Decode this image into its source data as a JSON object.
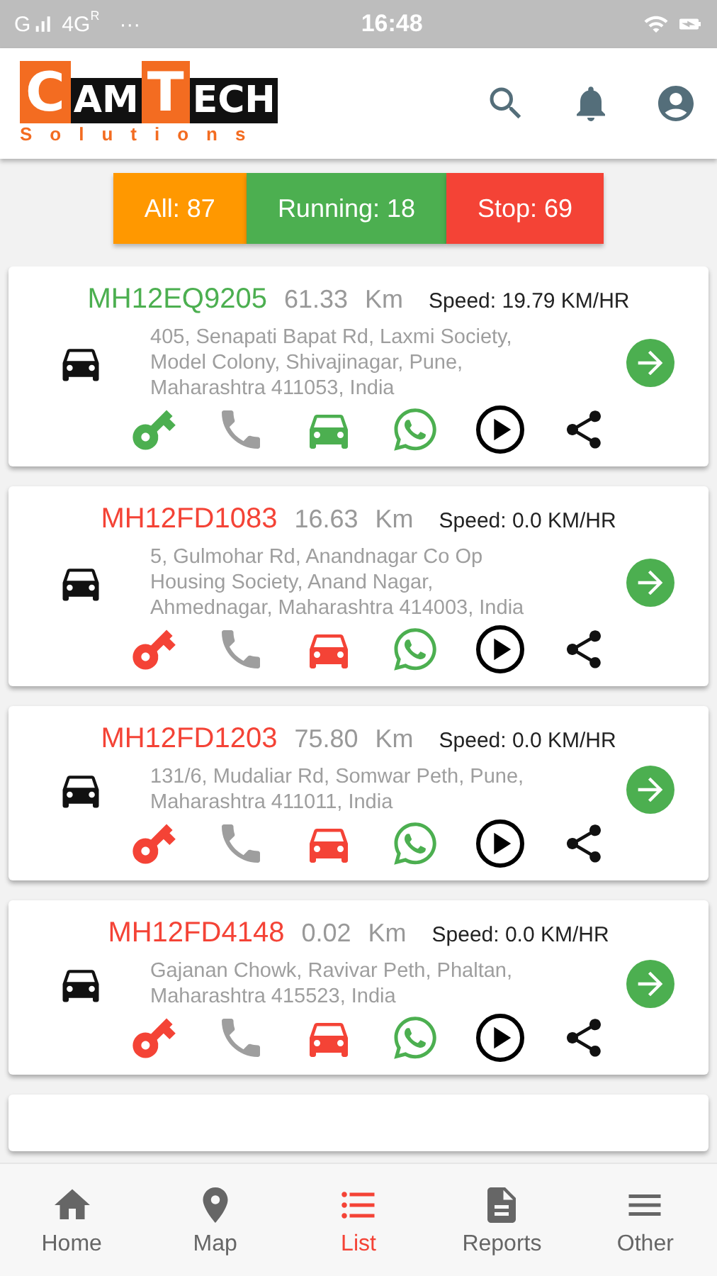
{
  "status_bar": {
    "carrier": "G",
    "network": "4G",
    "roaming": "R",
    "dots": "···",
    "time": "16:48"
  },
  "logo": {
    "letters": [
      {
        "text": "C",
        "boxed": true
      },
      {
        "text": "AM",
        "boxed": false
      },
      {
        "text": "T",
        "boxed": true
      },
      {
        "text": "ECH",
        "boxed": false
      }
    ],
    "tagline": "Solutions"
  },
  "filters": [
    {
      "label": "All: 87",
      "color": "#ff9800"
    },
    {
      "label": "Running: 18",
      "color": "#4caf50"
    },
    {
      "label": "Stop: 69",
      "color": "#f44336"
    }
  ],
  "vehicles": [
    {
      "plate": "MH12EQ9205",
      "distance": "61.33",
      "unit": "Km",
      "speed": "Speed: 19.79 KM/HR",
      "address": "405, Senapati Bapat Rd, Laxmi Society, Model Colony, Shivajinagar, Pune, Maharashtra 411053, India",
      "running": true
    },
    {
      "plate": "MH12FD1083",
      "distance": "16.63",
      "unit": "Km",
      "speed": "Speed: 0.0 KM/HR",
      "address": "5, Gulmohar Rd, Anandnagar Co Op Housing Society, Anand Nagar, Ahmednagar, Maharashtra 414003, India",
      "running": false
    },
    {
      "plate": "MH12FD1203",
      "distance": "75.80",
      "unit": "Km",
      "speed": "Speed: 0.0 KM/HR",
      "address": "131/6, Mudaliar Rd, Somwar Peth, Pune, Maharashtra 411011, India",
      "running": false
    },
    {
      "plate": "MH12FD4148",
      "distance": "0.02",
      "unit": "Km",
      "speed": "Speed: 0.0 KM/HR",
      "address": "Gajanan Chowk, Ravivar Peth, Phaltan, Maharashtra 415523, India",
      "running": false
    }
  ],
  "nav": [
    {
      "label": "Home",
      "selected": false
    },
    {
      "label": "Map",
      "selected": false
    },
    {
      "label": "List",
      "selected": true
    },
    {
      "label": "Reports",
      "selected": false
    },
    {
      "label": "Other",
      "selected": false
    }
  ]
}
